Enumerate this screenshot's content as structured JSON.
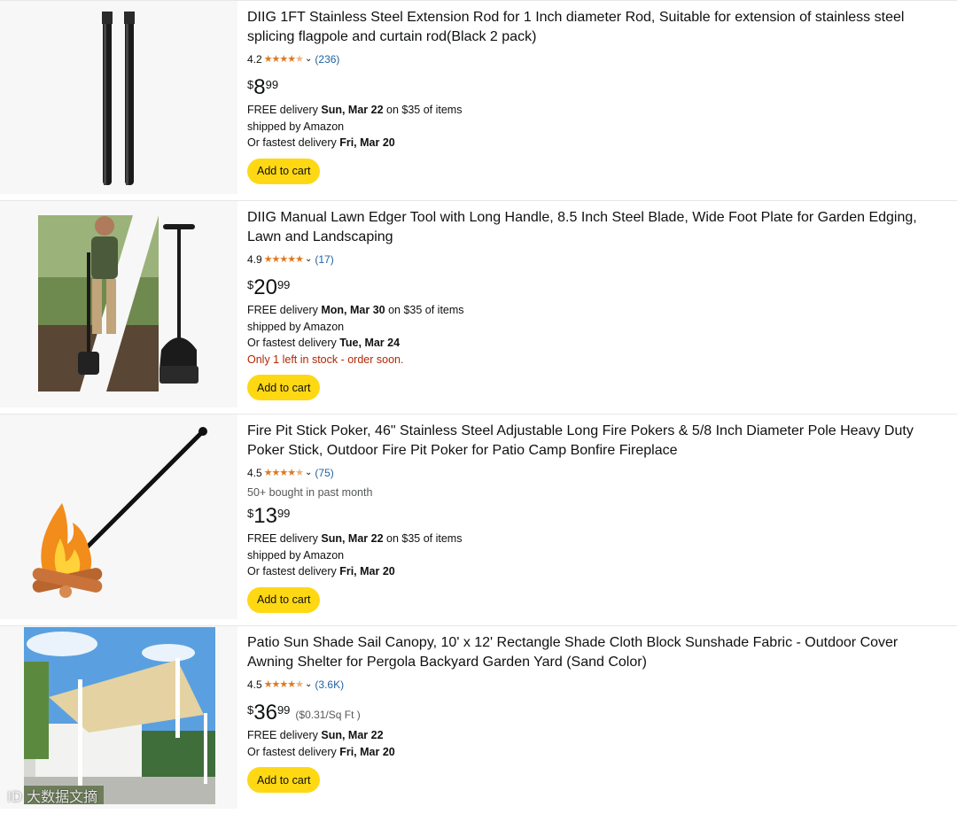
{
  "products": [
    {
      "title": "DIIG 1FT Stainless Steel Extension Rod for 1 Inch diameter Rod, Suitable for extension of stainless steel splicing flagpole and curtain rod(Black 2 pack)",
      "rating": "4.2",
      "stars_fraction": 0.84,
      "reviews": "(236)",
      "price_whole": "8",
      "price_fraction": "99",
      "delivery_prefix": "FREE delivery ",
      "delivery_date": "Sun, Mar 22",
      "delivery_suffix": " on $35 of items",
      "shipped": "shipped by Amazon",
      "fastest_prefix": "Or fastest delivery ",
      "fastest_date": "Fri, Mar 20",
      "cart_label": "Add to cart",
      "image_icon": "extension-rod-image"
    },
    {
      "title": "DIIG Manual Lawn Edger Tool with Long Handle, 8.5 Inch Steel Blade, Wide Foot Plate for Garden Edging, Lawn and Landscaping",
      "rating": "4.9",
      "stars_fraction": 0.98,
      "reviews": "(17)",
      "price_whole": "20",
      "price_fraction": "99",
      "delivery_prefix": "FREE delivery ",
      "delivery_date": "Mon, Mar 30",
      "delivery_suffix": " on $35 of items",
      "shipped": "shipped by Amazon",
      "fastest_prefix": "Or fastest delivery ",
      "fastest_date": "Tue, Mar 24",
      "stock": "Only 1 left in stock - order soon.",
      "cart_label": "Add to cart",
      "image_icon": "lawn-edger-image"
    },
    {
      "title": "Fire Pit Stick Poker, 46\" Stainless Steel Adjustable Long Fire Pokers & 5/8 Inch Diameter Pole Heavy Duty Poker Stick, Outdoor Fire Pit Poker for Patio Camp Bonfire Fireplace",
      "rating": "4.5",
      "stars_fraction": 0.9,
      "reviews": "(75)",
      "bought": "50+ bought in past month",
      "price_whole": "13",
      "price_fraction": "99",
      "delivery_prefix": "FREE delivery ",
      "delivery_date": "Sun, Mar 22",
      "delivery_suffix": " on $35 of items",
      "shipped": "shipped by Amazon",
      "fastest_prefix": "Or fastest delivery ",
      "fastest_date": "Fri, Mar 20",
      "cart_label": "Add to cart",
      "image_icon": "fire-poker-image"
    },
    {
      "title": "Patio Sun Shade Sail Canopy, 10' x 12' Rectangle Shade Cloth Block Sunshade Fabric - Outdoor Cover Awning Shelter for Pergola Backyard Garden Yard (Sand Color)",
      "rating": "4.5",
      "stars_fraction": 0.9,
      "reviews": "(3.6K)",
      "price_whole": "36",
      "price_fraction": "99",
      "unit_price": "($0.31/Sq Ft )",
      "delivery_prefix": "FREE delivery ",
      "delivery_date": "Sun, Mar 22",
      "fastest_prefix": "Or fastest delivery ",
      "fastest_date": "Fri, Mar 20",
      "cart_label": "Add to cart",
      "image_icon": "shade-sail-image"
    }
  ],
  "currency_symbol": "$",
  "watermark": "ID 大数据文摘",
  "colors": {
    "star": "#de7921",
    "link": "#2162a1",
    "cart_button": "#ffd814",
    "stock_warning": "#b12704"
  }
}
